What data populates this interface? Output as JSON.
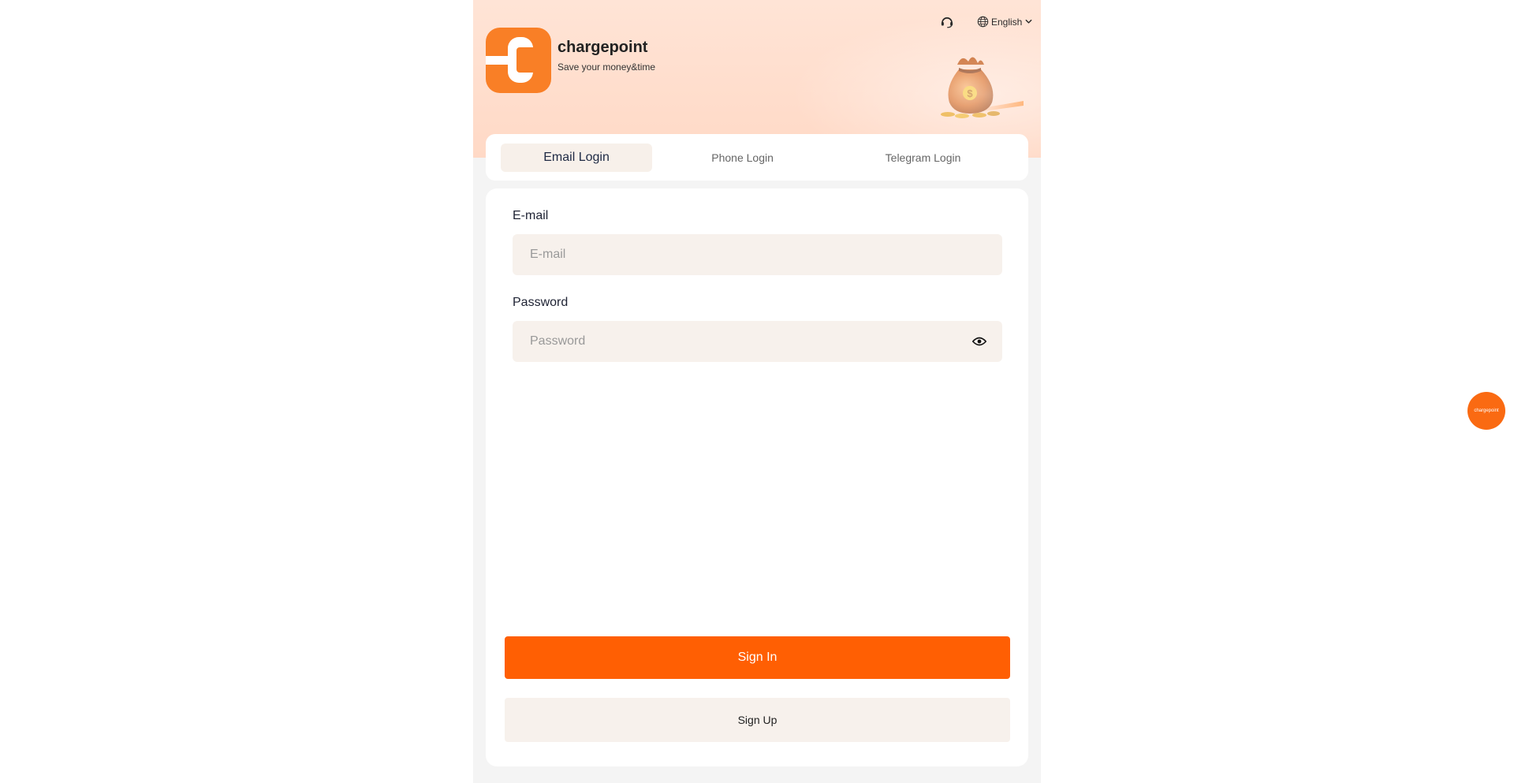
{
  "brand": {
    "name": "chargepoint",
    "tagline": "Save your money&time"
  },
  "header": {
    "language": "English"
  },
  "tabs": [
    {
      "label": "Email Login",
      "active": true
    },
    {
      "label": "Phone Login",
      "active": false
    },
    {
      "label": "Telegram Login",
      "active": false
    }
  ],
  "form": {
    "email_label": "E-mail",
    "email_placeholder": "E-mail",
    "email_value": "",
    "password_label": "Password",
    "password_placeholder": "Password",
    "password_value": ""
  },
  "actions": {
    "signin_label": "Sign In",
    "signup_label": "Sign Up"
  },
  "float_badge": {
    "label": "chargepoint"
  },
  "colors": {
    "accent": "#ff5f03",
    "logo": "#f97f26",
    "input_bg": "#f7f1ec",
    "page_bg": "#f4f4f4"
  },
  "icons": {
    "support": "headset-icon",
    "language": "globe-icon",
    "dropdown": "chevron-down-icon",
    "password_toggle": "eye-icon",
    "hero": "money-bag-icon"
  }
}
